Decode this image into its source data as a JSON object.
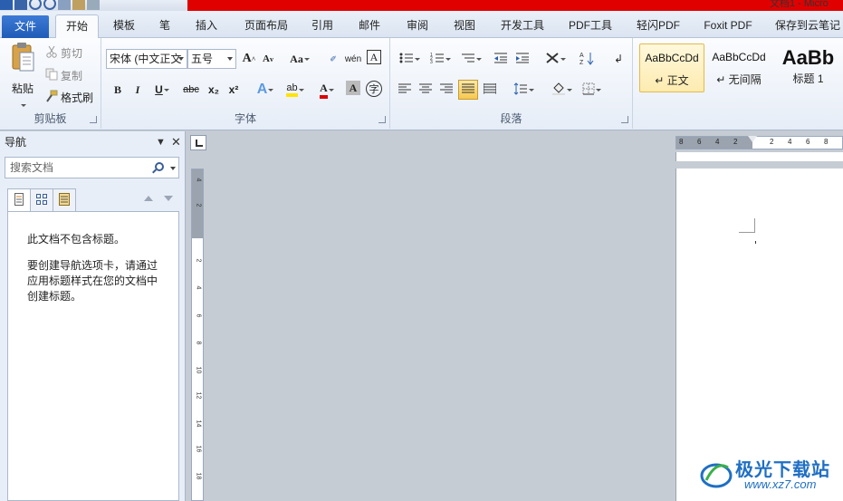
{
  "window": {
    "title": "文档1 - Micro"
  },
  "tabs": [
    {
      "label": "文件"
    },
    {
      "label": "开始"
    },
    {
      "label": "模板"
    },
    {
      "label": "笔"
    },
    {
      "label": "插入"
    },
    {
      "label": "页面布局"
    },
    {
      "label": "引用"
    },
    {
      "label": "邮件"
    },
    {
      "label": "审阅"
    },
    {
      "label": "视图"
    },
    {
      "label": "开发工具"
    },
    {
      "label": "PDF工具"
    },
    {
      "label": "轻闪PDF"
    },
    {
      "label": "Foxit PDF"
    },
    {
      "label": "保存到云笔记"
    }
  ],
  "clipboard": {
    "paste": "粘贴",
    "cut": "剪切",
    "copy": "复制",
    "format_painter": "格式刷",
    "label": "剪贴板"
  },
  "font": {
    "name": "宋体 (中文正文",
    "size": "五号",
    "label": "字体",
    "grow": "A",
    "shrink": "A",
    "case": "Aa",
    "bold": "B",
    "italic": "I",
    "underline": "U",
    "strike": "abc",
    "subscript": "x₂",
    "superscript": "x²",
    "text_effect": "A",
    "highlight": "ab",
    "font_color": "A",
    "char_shade": "A",
    "enclose": "字",
    "pinyin": "wén",
    "border_char": "A"
  },
  "paragraph": {
    "label": "段落"
  },
  "styles": {
    "items": [
      {
        "sample": "AaBbCcDd",
        "name": "↵ 正文"
      },
      {
        "sample": "AaBbCcDd",
        "name": "↵ 无间隔"
      },
      {
        "sample": "AaBb",
        "name": "标题 1"
      }
    ]
  },
  "nav": {
    "title": "导航",
    "search_placeholder": "搜索文档",
    "message1": "此文档不包含标题。",
    "message2": "要创建导航选项卡，请通过应用标题样式在您的文档中创建标题。"
  },
  "ruler": {
    "horizontal": [
      "8",
      "6",
      "4",
      "2",
      "2",
      "4",
      "6",
      "8"
    ],
    "vertical": [
      "4",
      "2",
      "2",
      "4",
      "6",
      "8",
      "10",
      "12",
      "14",
      "16",
      "18"
    ]
  },
  "watermark": {
    "title": "极光下载站",
    "url": "www.xz7.com"
  },
  "colors": {
    "accent": "#1f5cb8",
    "titlebar_red": "#e00000",
    "highlight_active": "#fdebb0"
  }
}
